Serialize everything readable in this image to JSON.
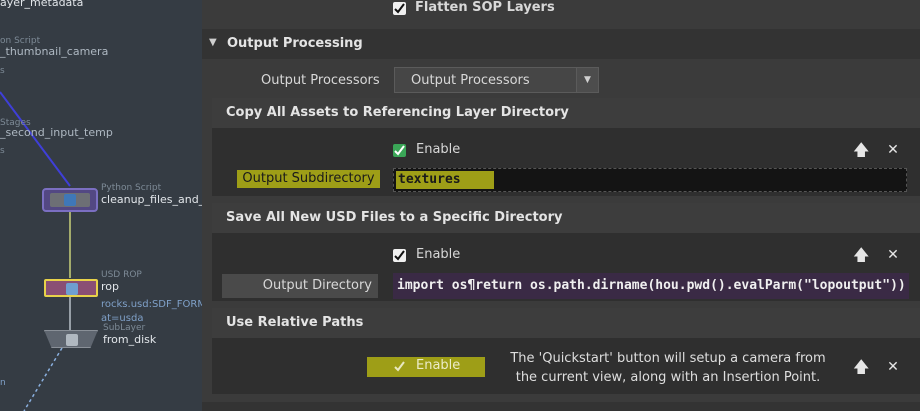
{
  "network": {
    "nodes": [
      {
        "type": "",
        "name": "ayer_metadata"
      },
      {
        "type": "on Script",
        "name": "_thumbnail_camera"
      },
      {
        "type": "Stages",
        "name": "_second_input_temp"
      },
      {
        "type": "Python Script",
        "name": "cleanup_files_and_u"
      },
      {
        "type": "USD ROP",
        "name": "rop",
        "flag": "rocks.usd:SDF_FORMAT",
        "flag2": "at=usda"
      },
      {
        "type": "SubLayer",
        "name": "from_disk"
      }
    ],
    "edge_label_1": "s",
    "edge_label_2": "s",
    "edge_label_3": "n"
  },
  "params": {
    "flatten_sop": {
      "label": "Flatten SOP Layers",
      "checked": true
    },
    "output_processing": {
      "title": "Output Processing",
      "expander": "▼",
      "processors_label": "Output Processors",
      "processors_value": "Output Processors",
      "menu_arrow": "▼"
    },
    "copy_assets": {
      "title": "Copy All Assets to Referencing Layer Directory",
      "enable_label": "Enable",
      "enable_checked": true,
      "field_label": "Output Subdirectory",
      "field_value": "textures"
    },
    "save_usd": {
      "title": "Save All New USD Files to a Specific Directory",
      "enable_label": "Enable",
      "enable_checked": true,
      "field_label": "Output Directory",
      "field_value": "import os¶return os.path.dirname(hou.pwd().evalParm(\"lopoutput\"))"
    },
    "relative_paths": {
      "title": "Use Relative Paths",
      "enable_label": "Enable",
      "enable_checked": true
    },
    "tooltip": "The 'Quickstart' button will setup a camera from the current view, along with an Insertion Point.",
    "up_glyph": "🡅",
    "close_glyph": "✕"
  },
  "colors": {
    "highlight": "#9e9e17",
    "network_bg": "#353c44",
    "wire": "#3f3fd8",
    "param_bg": "#3b3b3b"
  }
}
